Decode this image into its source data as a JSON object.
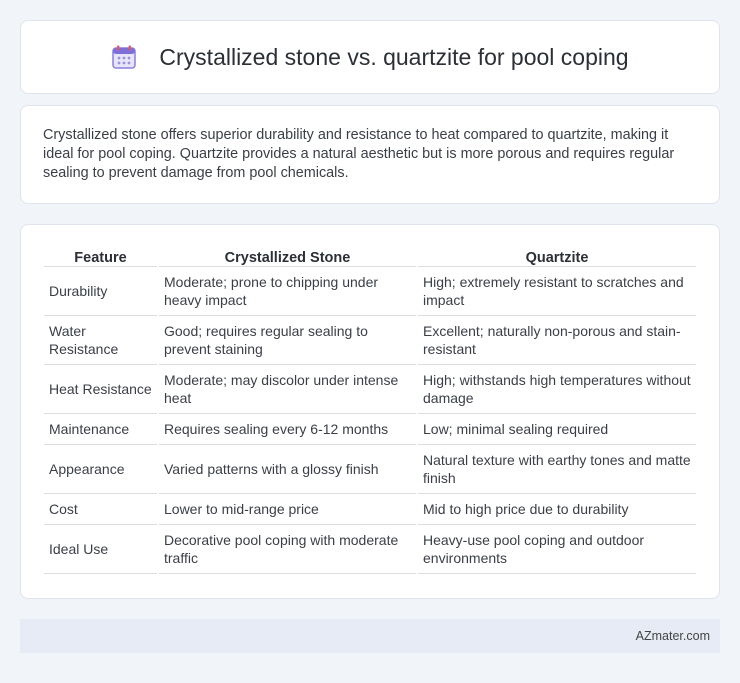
{
  "header": {
    "title": "Crystallized stone vs. quartzite for pool coping",
    "icon": "calendar-icon",
    "icon_color": "#7c6fd8"
  },
  "summary": {
    "text": "Crystallized stone offers superior durability and resistance to heat compared to quartzite, making it ideal for pool coping. Quartzite provides a natural aesthetic but is more porous and requires regular sealing to prevent damage from pool chemicals."
  },
  "table": {
    "headers": [
      "Feature",
      "Crystallized Stone",
      "Quartzite"
    ],
    "rows": [
      [
        "Durability",
        "Moderate; prone to chipping under heavy impact",
        "High; extremely resistant to scratches and impact"
      ],
      [
        "Water Resistance",
        "Good; requires regular sealing to prevent staining",
        "Excellent; naturally non-porous and stain-resistant"
      ],
      [
        "Heat Resistance",
        "Moderate; may discolor under intense heat",
        "High; withstands high temperatures without damage"
      ],
      [
        "Maintenance",
        "Requires sealing every 6-12 months",
        "Low; minimal sealing required"
      ],
      [
        "Appearance",
        "Varied patterns with a glossy finish",
        "Natural texture with earthy tones and matte finish"
      ],
      [
        "Cost",
        "Lower to mid-range price",
        "Mid to high price due to durability"
      ],
      [
        "Ideal Use",
        "Decorative pool coping with moderate traffic",
        "Heavy-use pool coping and outdoor environments"
      ]
    ]
  },
  "footer": {
    "brand": "AZmater.com"
  }
}
